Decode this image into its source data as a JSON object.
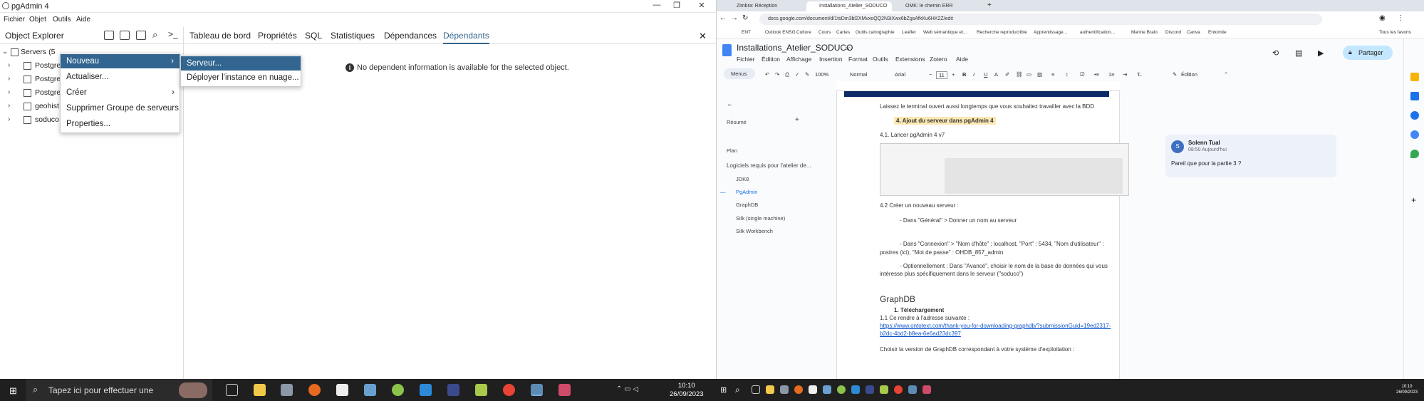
{
  "pgadmin": {
    "window_title": "pgAdmin 4",
    "menu": [
      "Fichier",
      "Objet",
      "Outils",
      "Aide"
    ],
    "explorer_title": "Object Explorer",
    "tree": [
      {
        "label": "Servers (5"
      },
      {
        "label": "Postgre"
      },
      {
        "label": "Postgre"
      },
      {
        "label": "Postgre"
      },
      {
        "label": "geohist"
      },
      {
        "label": "soduco"
      }
    ],
    "tabs": [
      "Tableau de bord",
      "Propriétés",
      "SQL",
      "Statistiques",
      "Dépendances",
      "Dépendants"
    ],
    "active_tab": "Dépendants",
    "info_message": "No dependent information is available for the selected object.",
    "context_menu": [
      "Nouveau",
      "Actualiser...",
      "Créer",
      "Supprimer Groupe de serveurs",
      "Properties..."
    ],
    "submenu": [
      "Serveur...",
      "Déployer l'instance en nuage..."
    ]
  },
  "taskbar": {
    "search_placeholder": "Tapez ici pour effectuer une",
    "time": "10:10",
    "date": "26/09/2023",
    "time_right": "10:10",
    "date_right": "26/09/2023"
  },
  "chrome": {
    "tabs": [
      "Zimbra: Réception",
      "Installations_Atelier_SODUCO",
      "OMK: le chemin ERR"
    ],
    "url": "docs.google.com/document/d/1tsDm3bl2XMvxoQQ2N3iXwx6bZgsAfkKu6HK2Z/edit",
    "bookmarks": [
      "ENT",
      "Outlook ENSG",
      "Culture",
      "Cours",
      "Cartes",
      "Outils cartographie",
      "Leaflet",
      "Web sémantique et...",
      "Recherche reproductible",
      "Apprentissage...",
      "authentification...",
      "Marine Bralo",
      "Discord",
      "Canva",
      "Entomite",
      "Tous les favoris"
    ]
  },
  "doc": {
    "title": "Installations_Atelier_SODUCO",
    "menu": [
      "Fichier",
      "Édition",
      "Affichage",
      "Insertion",
      "Format",
      "Outils",
      "Extensions",
      "Zotero",
      "Aide"
    ],
    "menus_label": "Menus",
    "zoom": "100%",
    "style": "Normal",
    "font": "Arial",
    "font_size": "11",
    "mode": "Édition",
    "share": "Partager",
    "avatar_letter": "S",
    "outline": {
      "heading": "Résumé",
      "plan": "Plan",
      "items": [
        "Logiciels requis pour l'atelier de...",
        "JDK8",
        "PgAdmin",
        "GraphDB",
        "Silk (single machine)",
        "Silk Workbench"
      ]
    },
    "body": {
      "p1": "Laissez le terminal ouvert aussi longtemps que vous souhaitez travailler avec la BDD",
      "h4": "4.   Ajout du serveur dans pgAdmin 4",
      "s41": "4.1. Lancer pgAdmin 4 v7",
      "s42": "4.2 Créer un nouveau serveur :",
      "b1": "- Dans \"Général\" > Donner un nom au serveur",
      "b2": "- Dans \"Connexion\" > \"Nom d'hôte\" : localhost, \"Port\" : 5434, \"Nom d'utilisateur\" :",
      "b2b": "postres (ici), \"Mot de passe\" : OHDB_857_admin",
      "b3": "- Optionnellement : Dans \"Avancé\", choisir le nom de la base de données qui vous",
      "b3b": "intéresse plus spécifiquement dans le serveur (\"soduco\")",
      "h_graphdb": "GraphDB",
      "h_tel": "1.   Téléchargement",
      "s11": "1.1 Ce rendre à l'adresse suivante :",
      "link1": "https://www.ontotext.com/thank-you-for-downloading-graphdb/?submissionGuid=19ed2317-",
      "link2": "b2dc-4bd2-b8ea-6e6ad23dc397",
      "last": "Choisir la version de GraphDB correspondant à votre système d'exploitation :"
    },
    "comment": {
      "author": "Solenn Tual",
      "time": "08:50 Aujourd'hui",
      "text": "Pareil que pour la partie 3 ?",
      "initial": "S"
    }
  },
  "colors": {
    "accent": "#326690",
    "taskbar": "#1f1f1f",
    "link": "#1155cc"
  }
}
